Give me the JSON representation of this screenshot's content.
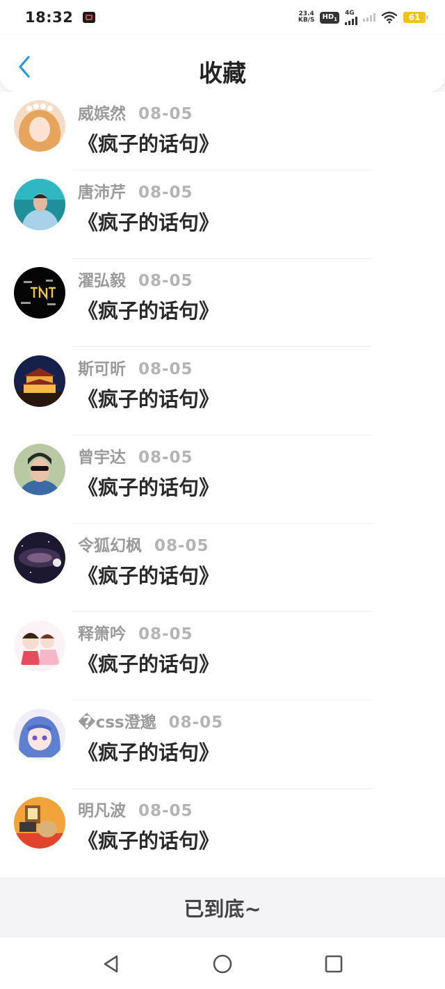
{
  "status_bar": {
    "time": "18:32",
    "net_speed_value": "23.4",
    "net_speed_unit": "KB/S",
    "hd_label": "HD",
    "sim_index": "1",
    "network_type": "4G",
    "battery": "61",
    "icons": [
      "screen-record-icon",
      "hd-icon",
      "signal-icon",
      "wifi-icon",
      "battery-icon"
    ]
  },
  "header": {
    "title": "收藏",
    "back_icon": "chevron-left-icon",
    "accent_color": "#1e9be6"
  },
  "list": {
    "items": [
      {
        "name": "威嫔然",
        "date": "08-05",
        "title": "《疯子的话句》"
      },
      {
        "name": "唐沛芹",
        "date": "08-05",
        "title": "《疯子的话句》"
      },
      {
        "name": "濯弘毅",
        "date": "08-05",
        "title": "《疯子的话句》"
      },
      {
        "name": "斯可昕",
        "date": "08-05",
        "title": "《疯子的话句》"
      },
      {
        "name": "曾宇达",
        "date": "08-05",
        "title": "《疯子的话句》"
      },
      {
        "name": "令狐幻枫",
        "date": "08-05",
        "title": "《疯子的话句》"
      },
      {
        "name": "释箫吟",
        "date": "08-05",
        "title": "《疯子的话句》"
      },
      {
        "name": "�css澄邈",
        "date": "08-05",
        "title": "《疯子的话句》"
      },
      {
        "name": "明凡波",
        "date": "08-05",
        "title": "《疯子的话句》"
      }
    ]
  },
  "footer": {
    "end_text": "已到底~"
  },
  "nav": {
    "icons": [
      "back-triangle-icon",
      "home-circle-icon",
      "recents-square-icon"
    ]
  }
}
